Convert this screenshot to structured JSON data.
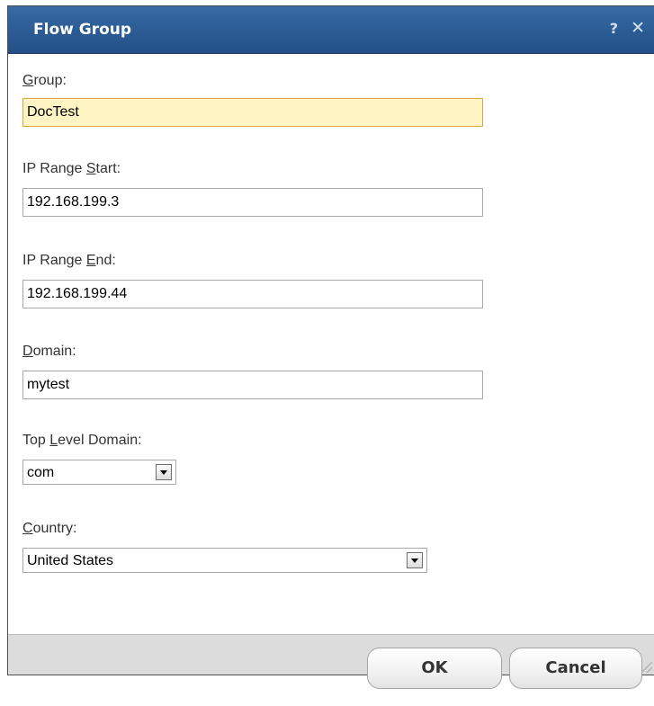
{
  "dialog": {
    "title": "Flow Group",
    "help_glyph": "?",
    "close_glyph": "✕"
  },
  "form": {
    "group": {
      "label_prefix": "",
      "label_key": "G",
      "label_rest": "roup:",
      "value": "DocTest"
    },
    "ip_start": {
      "label_prefix": "IP Range ",
      "label_key": "S",
      "label_rest": "tart:",
      "value": "192.168.199.3"
    },
    "ip_end": {
      "label_prefix": "IP Range ",
      "label_key": "E",
      "label_rest": "nd:",
      "value": "192.168.199.44"
    },
    "domain": {
      "label_prefix": "",
      "label_key": "D",
      "label_rest": "omain:",
      "value": "mytest"
    },
    "tld": {
      "label_prefix": "Top ",
      "label_key": "L",
      "label_rest": "evel Domain:",
      "value": "com"
    },
    "country": {
      "label_prefix": "",
      "label_key": "C",
      "label_rest": "ountry:",
      "value": "United States"
    }
  },
  "footer": {
    "ok_label": "OK",
    "cancel_label": "Cancel"
  },
  "colors": {
    "titlebar": "#2e5e97",
    "focused_field": "#fff5c4",
    "footer": "#dcdcdc"
  },
  "icons": {
    "help": "help-icon",
    "close": "close-icon",
    "dropdown": "chevron-down-icon"
  }
}
